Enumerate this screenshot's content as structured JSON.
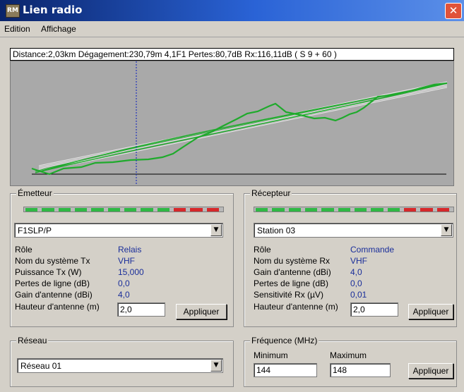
{
  "window": {
    "title": "Lien radio",
    "icon_text": "RM",
    "close_glyph": "✕"
  },
  "menu": [
    "Edition",
    "Affichage"
  ],
  "status_line": "Distance:2,03km  Dégagement:230,79m  4,1F1  Pertes:80,7dB  Rx:116,11dB  ( S 9 + 60 )",
  "colors": {
    "terrain": "#1faa2c",
    "fresnel": "#e9e9e9",
    "marker": "#2233bb",
    "meter_green": "#2fb844",
    "meter_red": "#d6282a"
  },
  "emitter": {
    "legend": "Émetteur",
    "meter_segments": [
      "green",
      "green",
      "green",
      "green",
      "green",
      "green",
      "green",
      "green",
      "green",
      "red",
      "red",
      "red"
    ],
    "station": "F1SLP/P",
    "rows": [
      {
        "label": "Rôle",
        "value": "Relais"
      },
      {
        "label": "Nom du système Tx",
        "value": "VHF"
      },
      {
        "label": "Puissance Tx (W)",
        "value": "15,000"
      },
      {
        "label": "Pertes de ligne (dB)",
        "value": "0,0"
      },
      {
        "label": "Gain d'antenne (dBi)",
        "value": "4,0"
      }
    ],
    "height_label": "Hauteur d'antenne (m)",
    "height_value": "2,0",
    "apply": "Appliquer"
  },
  "receiver": {
    "legend": "Récepteur",
    "meter_segments": [
      "green",
      "green",
      "green",
      "green",
      "green",
      "green",
      "green",
      "green",
      "green",
      "red",
      "red",
      "red"
    ],
    "station": "Station 03",
    "rows": [
      {
        "label": "Rôle",
        "value": "Commande"
      },
      {
        "label": "Nom du système Rx",
        "value": "VHF"
      },
      {
        "label": "Gain d'antenne (dBi)",
        "value": "4,0"
      },
      {
        "label": "Pertes de ligne (dB)",
        "value": "0,0"
      },
      {
        "label": "Sensitivité Rx (µV)",
        "value": "0,01"
      }
    ],
    "height_label": "Hauteur d'antenne (m)",
    "height_value": "2,0",
    "apply": "Appliquer"
  },
  "network": {
    "legend": "Réseau",
    "value": "Réseau 01"
  },
  "frequency": {
    "legend": "Fréquence (MHz)",
    "min_label": "Minimum",
    "min_value": "144",
    "max_label": "Maximum",
    "max_value": "148",
    "apply": "Appliquer"
  }
}
